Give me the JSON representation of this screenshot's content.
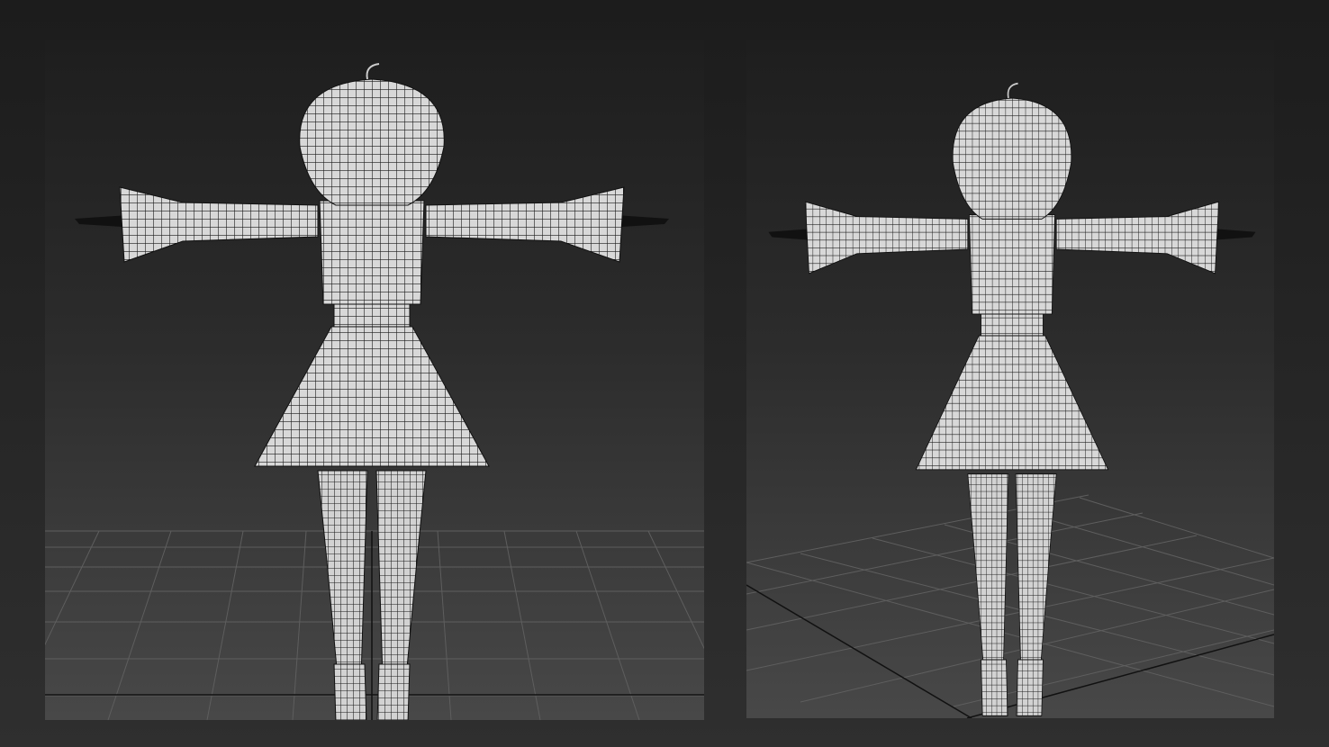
{
  "viewports": [
    {
      "view": "front-orthographic"
    },
    {
      "view": "perspective"
    }
  ],
  "colors": {
    "background": "#262626",
    "grid": "#6a6a6a",
    "mesh_fill": "#d6d6d6",
    "mesh_wire": "#1a1a1a"
  }
}
